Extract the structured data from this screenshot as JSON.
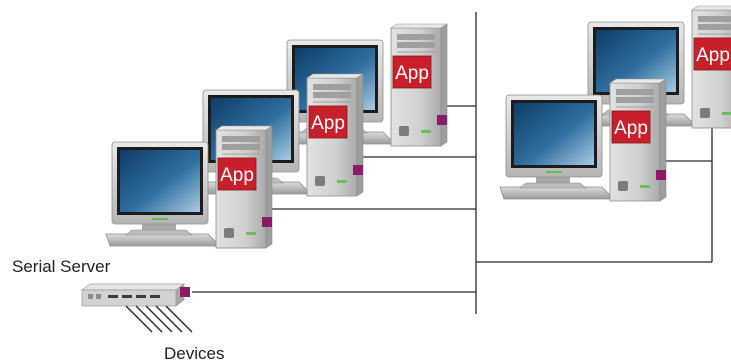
{
  "diagram": {
    "nodes": {
      "serial_server": {
        "label": "Serial Server",
        "icon": "serial-server-icon"
      },
      "devices": {
        "label": "Devices",
        "icon": "device-cables-icon"
      },
      "workstations": [
        {
          "icon": "workstation-icon",
          "app_label": "App"
        },
        {
          "icon": "workstation-icon",
          "app_label": "App"
        },
        {
          "icon": "workstation-icon",
          "app_label": "App"
        },
        {
          "icon": "workstation-icon",
          "app_label": "App"
        },
        {
          "icon": "workstation-icon",
          "app_label": "App"
        }
      ]
    },
    "colors": {
      "line": "#2a2a2a",
      "port": "#8a1a6a",
      "app_badge": "#c8202a",
      "tower": "#c8c8c8",
      "screen_dark": "#0f3d66",
      "screen_light": "#6fa6cf"
    }
  }
}
